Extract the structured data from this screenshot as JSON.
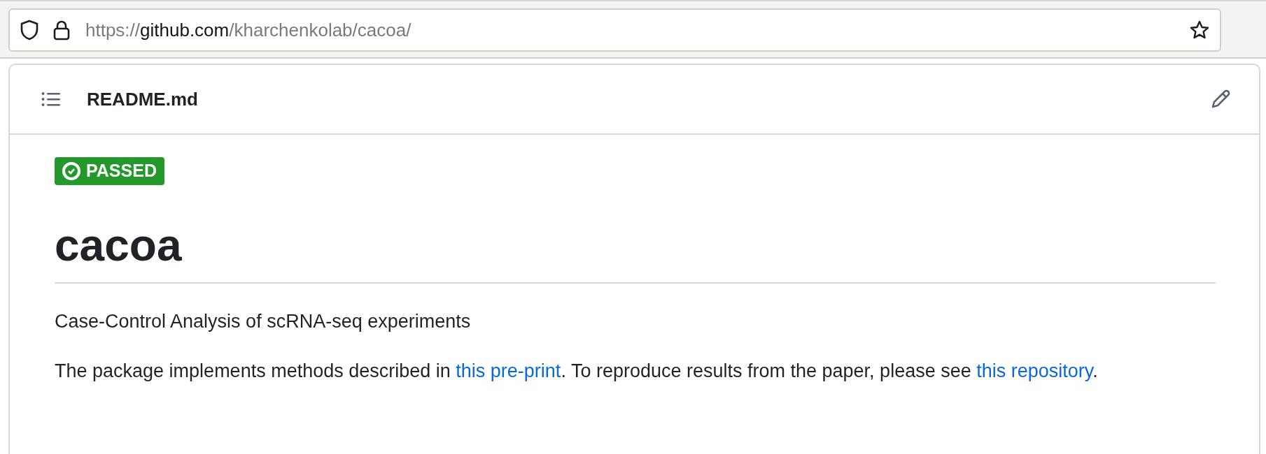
{
  "address_bar": {
    "url_parts": [
      {
        "kind": "dim",
        "text": "https://"
      },
      {
        "kind": "host",
        "text": "github.com"
      },
      {
        "kind": "dim",
        "text": "/kharchenkolab/cacoa/"
      }
    ]
  },
  "readme": {
    "filename": "README.md",
    "badge": {
      "label": "PASSED",
      "color": "#22992a"
    },
    "title": "cacoa",
    "tagline": "Case-Control Analysis of scRNA-seq experiments",
    "paragraph": [
      {
        "kind": "text",
        "text": "The package implements methods described in "
      },
      {
        "kind": "link",
        "text": "this pre-print"
      },
      {
        "kind": "text",
        "text": ". To reproduce results from the paper, please see "
      },
      {
        "kind": "link",
        "text": "this repository"
      },
      {
        "kind": "text",
        "text": "."
      }
    ]
  }
}
